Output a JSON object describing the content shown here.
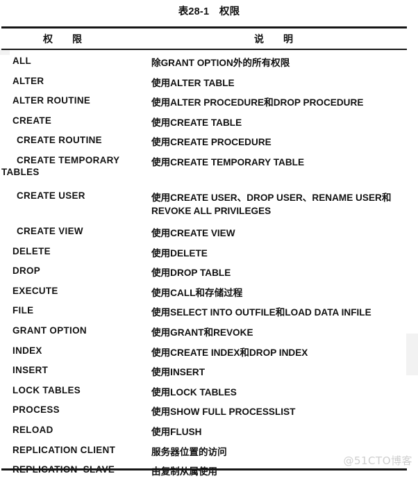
{
  "caption": "表28-1　权限",
  "table": {
    "headers": {
      "permission": "权　　限",
      "description": "说　　明"
    },
    "rows": [
      {
        "permission": "ALL",
        "description": "除GRANT OPTION外的所有权限"
      },
      {
        "permission": "ALTER",
        "description": "使用ALTER TABLE"
      },
      {
        "permission": "ALTER ROUTINE",
        "description": "使用ALTER PROCEDURE和DROP PROCEDURE"
      },
      {
        "permission": "CREATE",
        "description": "使用CREATE TABLE"
      },
      {
        "permission": "CREATE ROUTINE",
        "description": "使用CREATE PROCEDURE"
      },
      {
        "permission": "CREATE TEMPORARY",
        "permission_line2": "TABLES",
        "description": "使用CREATE TEMPORARY TABLE"
      },
      {
        "permission": "CREATE USER",
        "description": "使用CREATE USER、DROP USER、RENAME USER和",
        "description_line2": "REVOKE ALL PRIVILEGES"
      },
      {
        "permission": "CREATE VIEW",
        "description": "使用CREATE VIEW"
      },
      {
        "permission": "DELETE",
        "description": "使用DELETE"
      },
      {
        "permission": "DROP",
        "description": "使用DROP TABLE"
      },
      {
        "permission": "EXECUTE",
        "description": "使用CALL和存储过程"
      },
      {
        "permission": "FILE",
        "description": "使用SELECT INTO OUTFILE和LOAD DATA INFILE"
      },
      {
        "permission": "GRANT OPTION",
        "description": "使用GRANT和REVOKE"
      },
      {
        "permission": "INDEX",
        "description": "使用CREATE INDEX和DROP INDEX"
      },
      {
        "permission": "INSERT",
        "description": "使用INSERT"
      },
      {
        "permission": "LOCK TABLES",
        "description": "使用LOCK TABLES"
      },
      {
        "permission": "PROCESS",
        "description": "使用SHOW FULL PROCESSLIST"
      },
      {
        "permission": "RELOAD",
        "description": "使用FLUSH"
      },
      {
        "permission": "REPLICATION CLIENT",
        "description": "服务器位置的访问"
      },
      {
        "permission": "REPLICATION  SLAVE",
        "description": "由复制从属使用"
      }
    ]
  },
  "watermark": "@51CTO博客",
  "colors": {
    "text": "#111111",
    "rule": "#161616",
    "watermark": "#cfcfcf",
    "background": "#ffffff"
  }
}
